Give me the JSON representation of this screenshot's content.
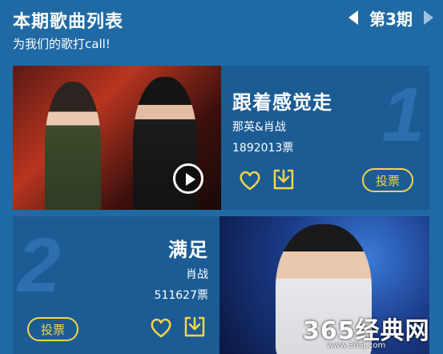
{
  "header": {
    "title": "本期歌曲列表",
    "subtitle": "为我们的歌打call!",
    "period": "第3期"
  },
  "songs": [
    {
      "rank": "1",
      "title": "跟着感觉走",
      "artist": "那英&肖战",
      "votes": "1892013票",
      "vote_label": "投票"
    },
    {
      "rank": "2",
      "title": "满足",
      "artist": "肖战",
      "votes": "511627票",
      "vote_label": "投票"
    }
  ],
  "watermark": {
    "main": "365经典网",
    "sub": "www.365j.com"
  },
  "colors": {
    "background": "#1f6aa5",
    "card": "#1b5c95",
    "accent": "#f5d548"
  },
  "icons": [
    "prev-arrow-icon",
    "next-arrow-icon",
    "play-icon",
    "heart-icon",
    "download-icon"
  ]
}
